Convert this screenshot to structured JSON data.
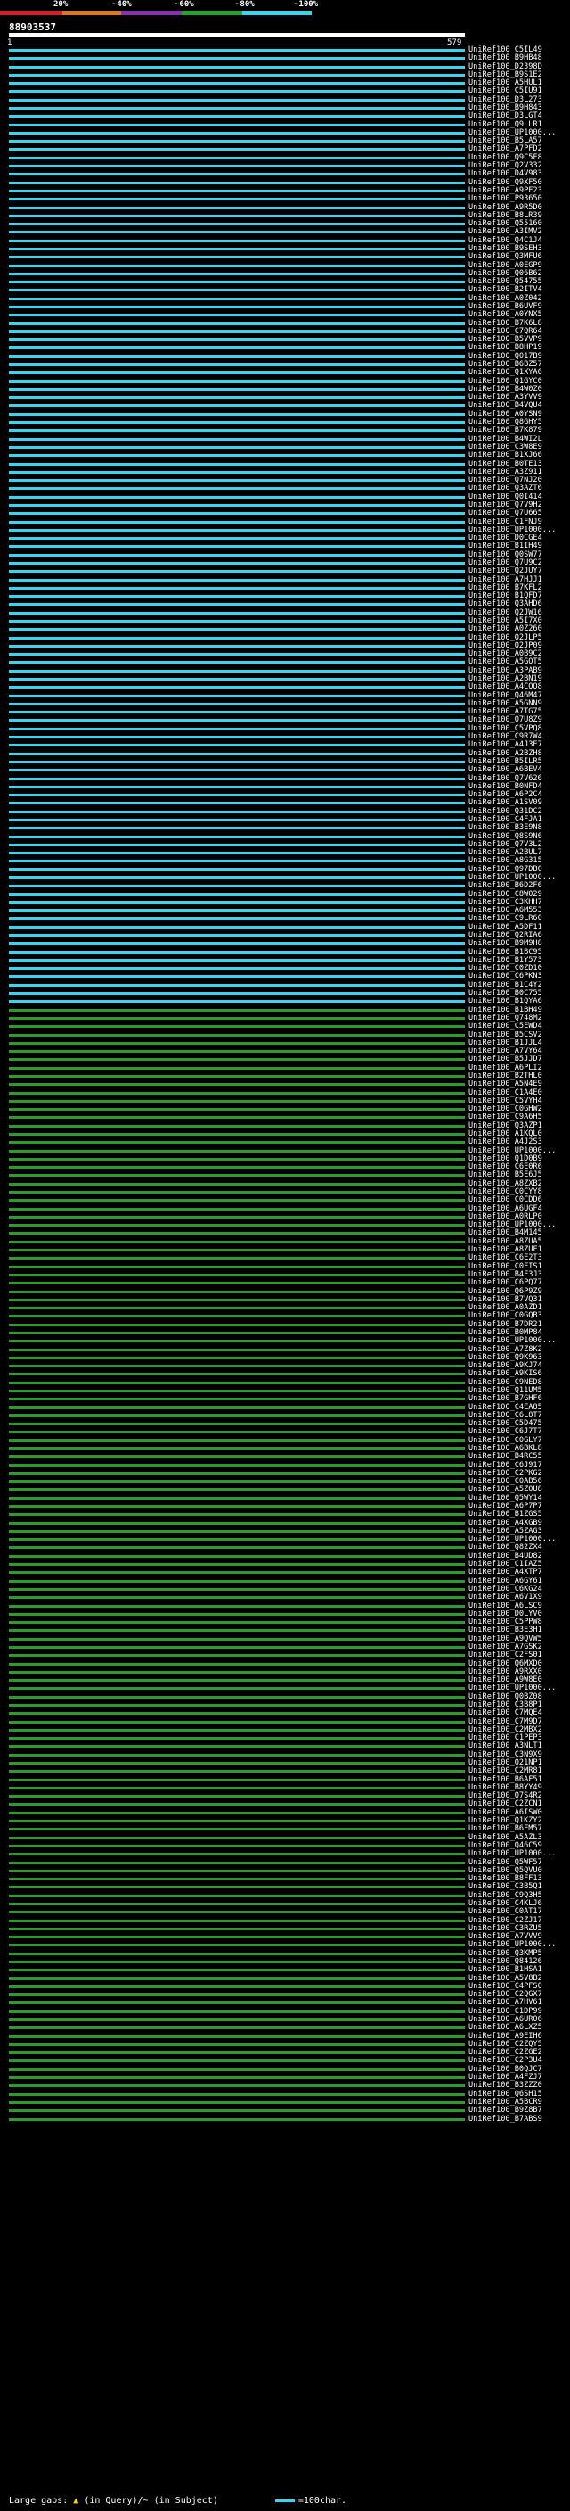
{
  "scale": {
    "labels": [
      "20%",
      "~40%",
      "~60%",
      "~80%",
      "~100%"
    ],
    "colors": [
      "#d61f2b",
      "#e07a18",
      "#8a2fb0",
      "#22a32a",
      "#3ad3f0"
    ]
  },
  "query_id": "88903537",
  "ruler": {
    "start": "1",
    "end": "579"
  },
  "bar_colors": {
    "cyan": "#3ad3f0",
    "green": "#2e9a2e"
  },
  "hits": [
    "UniRef100_C5IL49",
    "UniRef100_B9HB48",
    "UniRef100_D2398D",
    "UniRef100_B9S1E2",
    "UniRef100_A5HUL1",
    "UniRef100_C5IU91",
    "UniRef100_D3L273",
    "UniRef100_B9H843",
    "UniRef100_D3LGT4",
    "UniRef100_Q9LLR1",
    "UniRef100_UP1000...",
    "UniRef100_B5LA57",
    "UniRef100_A7PFD2",
    "UniRef100_Q9C5F8",
    "UniRef100_Q2V332",
    "UniRef100_D4V983",
    "UniRef100_Q9XF50",
    "UniRef100_A9PF23",
    "UniRef100_P93650",
    "UniRef100_A9R5D0",
    "UniRef100_B8LR39",
    "UniRef100_Q55160",
    "UniRef100_A3IMV2",
    "UniRef100_Q4C1J4",
    "UniRef100_B9SEH3",
    "UniRef100_Q3MFU6",
    "UniRef100_A0EGP9",
    "UniRef100_Q06B62",
    "UniRef100_Q54755",
    "UniRef100_B2ITV4",
    "UniRef100_A0Z042",
    "UniRef100_B6UVF9",
    "UniRef100_A0YNX5",
    "UniRef100_B7K6L8",
    "UniRef100_C7QR64",
    "UniRef100_B5VVP9",
    "UniRef100_B8HP19",
    "UniRef100_Q017B9",
    "UniRef100_B6BZ57",
    "UniRef100_Q1XYA6",
    "UniRef100_Q1GYC0",
    "UniRef100_B4W0Z0",
    "UniRef100_A3YVV9",
    "UniRef100_B4VQU4",
    "UniRef100_A0YSN9",
    "UniRef100_Q8GHY5",
    "UniRef100_B7K879",
    "UniRef100_B4WI2L",
    "UniRef100_C3W8E9",
    "UniRef100_B1XJ66",
    "UniRef100_B0TE13",
    "UniRef100_A3Z911",
    "UniRef100_Q7NJ20",
    "UniRef100_Q3AZT6",
    "UniRef100_Q0I414",
    "UniRef100_Q7V9H2",
    "UniRef100_Q7U665",
    "UniRef100_C1FNJ9",
    "UniRef100_UP1000...",
    "UniRef100_D0CGE4",
    "UniRef100_B1IH49",
    "UniRef100_Q0SW77",
    "UniRef100_Q7U9C2",
    "UniRef100_Q2JUY7",
    "UniRef100_A7HJJ1",
    "UniRef100_B7KFL2",
    "UniRef100_B1QFD7",
    "UniRef100_Q3AHD6",
    "UniRef100_Q2JW16",
    "UniRef100_A5I7X0",
    "UniRef100_A0Z260",
    "UniRef100_Q2JLP5",
    "UniRef100_Q2JP09",
    "UniRef100_A0B9C2",
    "UniRef100_A5GQT5",
    "UniRef100_A3PAB9",
    "UniRef100_A2BN19",
    "UniRef100_A4CQQ8",
    "UniRef100_Q46M47",
    "UniRef100_A5GNN9",
    "UniRef100_A7TG75",
    "UniRef100_Q7U8Z9",
    "UniRef100_C5VPQ8",
    "UniRef100_C9R7W4",
    "UniRef100_A4J3E7",
    "UniRef100_A2BZH8",
    "UniRef100_B5ILR5",
    "UniRef100_A6BEV4",
    "UniRef100_Q7V626",
    "UniRef100_B0NFD4",
    "UniRef100_A6P2C4",
    "UniRef100_A1SV09",
    "UniRef100_Q31DC2",
    "UniRef100_C4FJA1",
    "UniRef100_B3E9N8",
    "UniRef100_Q8S9N6",
    "UniRef100_Q7V3L2",
    "UniRef100_A2BUL7",
    "UniRef100_A8G315",
    "UniRef100_Q97DB0",
    "UniRef100_UP1000...",
    "UniRef100_B6D2F6",
    "UniRef100_C8W029",
    "UniRef100_C3KHH7",
    "UniRef100_A6M553",
    "UniRef100_C9LR60",
    "UniRef100_A5DF11",
    "UniRef100_Q2RIA6",
    "UniRef100_B9M9H8",
    "UniRef100_B1BC95",
    "UniRef100_B1Y573",
    "UniRef100_C0ZD10",
    "UniRef100_C6PKN3",
    "UniRef100_B1C4Y2",
    "UniRef100_B0C755",
    "UniRef100_B1QYA6",
    "UniRef100_B1BH49",
    "UniRef100_Q748M2",
    "UniRef100_C5EWD4",
    "UniRef100_B5CSV2",
    "UniRef100_B1JJL4",
    "UniRef100_A7VY64",
    "UniRef100_B5JJD7",
    "UniRef100_A6PLI2",
    "UniRef100_B2THL0",
    "UniRef100_A5N4E9",
    "UniRef100_C1A4E0",
    "UniRef100_C5VYH4",
    "UniRef100_C0GHW2",
    "UniRef100_C9A6H5",
    "UniRef100_Q3AZP1",
    "UniRef100_A1KQL0",
    "UniRef100_A4J2S3",
    "UniRef100_UP1000...",
    "UniRef100_Q1D0B9",
    "UniRef100_C6E0R6",
    "UniRef100_B5E6J5",
    "UniRef100_A8ZXB2",
    "UniRef100_C0CYY8",
    "UniRef100_C0CDD6",
    "UniRef100_A6UGF4",
    "UniRef100_A0RLP0",
    "UniRef100_UP1000...",
    "UniRef100_B4M145",
    "UniRef100_A8ZUA5",
    "UniRef100_A8ZUF1",
    "UniRef100_C6E2T3",
    "UniRef100_C0EIS1",
    "UniRef100_B4F3J3",
    "UniRef100_C6PQ77",
    "UniRef100_Q6P9Z9",
    "UniRef100_B7VQ31",
    "UniRef100_A0AZD1",
    "UniRef100_C0GQB3",
    "UniRef100_B7DR21",
    "UniRef100_B0MP84",
    "UniRef100_UP1000...",
    "UniRef100_A7Z8K2",
    "UniRef100_Q9K963",
    "UniRef100_A9KJ74",
    "UniRef100_A9KIS6",
    "UniRef100_C9NED8",
    "UniRef100_Q11UM5",
    "UniRef100_B7GHF6",
    "UniRef100_C4EA85",
    "UniRef100_C6L8T7",
    "UniRef100_C5D475",
    "UniRef100_C6J7T7",
    "UniRef100_C0GLY7",
    "UniRef100_A6BKL8",
    "UniRef100_B4RC55",
    "UniRef100_C6J917",
    "UniRef100_C2PKG2",
    "UniRef100_C0AB56",
    "UniRef100_A5Z0U8",
    "UniRef100_Q5WY14",
    "UniRef100_A6P7P7",
    "UniRef100_B1ZGS5",
    "UniRef100_A4XGB9",
    "UniRef100_A5ZAG3",
    "UniRef100_UP1000...",
    "UniRef100_Q82ZX4",
    "UniRef100_B4UD82",
    "UniRef100_C1IAZ5",
    "UniRef100_A4XTP7",
    "UniRef100_A6GY61",
    "UniRef100_C6KG24",
    "UniRef100_A6V1X9",
    "UniRef100_A6LSC9",
    "UniRef100_D0LYV0",
    "UniRef100_C5PPW8",
    "UniRef100_B3E3H1",
    "UniRef100_A9QVW5",
    "UniRef100_A7GSK2",
    "UniRef100_C2FS01",
    "UniRef100_Q6MXD0",
    "UniRef100_A9RXX0",
    "UniRef100_A9W8E0",
    "UniRef100_UP1000...",
    "UniRef100_Q0BZ08",
    "UniRef100_C3B8P1",
    "UniRef100_C7MQE4",
    "UniRef100_C7M9D7",
    "UniRef100_C2MBX2",
    "UniRef100_C1PEP3",
    "UniRef100_A3NLT1",
    "UniRef100_C3N9X9",
    "UniRef100_Q21NP1",
    "UniRef100_C2MR81",
    "UniRef100_B6AF51",
    "UniRef100_B8YY49",
    "UniRef100_Q7S4R2",
    "UniRef100_C2ZCN1",
    "UniRef100_A6ISW0",
    "UniRef100_Q1KZY2",
    "UniRef100_B6FM57",
    "UniRef100_A5AZL3",
    "UniRef100_Q46C59",
    "UniRef100_UP1000...",
    "UniRef100_Q5WF57",
    "UniRef100_Q5QVU0",
    "UniRef100_B8FF13",
    "UniRef100_C3B5Q1",
    "UniRef100_C9Q3H5",
    "UniRef100_C4KLJ6",
    "UniRef100_C0AT17",
    "UniRef100_C2ZJ17",
    "UniRef100_C3RZU5",
    "UniRef100_A7VVV9",
    "UniRef100_UP1000...",
    "UniRef100_Q3KMP5",
    "UniRef100_Q84126",
    "UniRef100_B1HSA1",
    "UniRef100_A5V8B2",
    "UniRef100_C4PFS0",
    "UniRef100_C2QGX7",
    "UniRef100_A7HV61",
    "UniRef100_C1DP99",
    "UniRef100_A6UR06",
    "UniRef100_A6LXZ5",
    "UniRef100_A9EIH6",
    "UniRef100_C2ZQY5",
    "UniRef100_C2ZGE2",
    "UniRef100_C2P3U4",
    "UniRef100_B0QJC7",
    "UniRef100_A4FZJ7",
    "UniRef100_B3ZZZ0",
    "UniRef100_Q6SH15",
    "UniRef100_A5BCR9",
    "UniRef100_B9Z8B7",
    "UniRef100_B7ABS9"
  ],
  "footer": {
    "large_gaps_label": "Large gaps:",
    "gap_marker": "▲",
    "gap_text": "(in Query)/~ (in Subject)",
    "legend_text": "=100char."
  }
}
